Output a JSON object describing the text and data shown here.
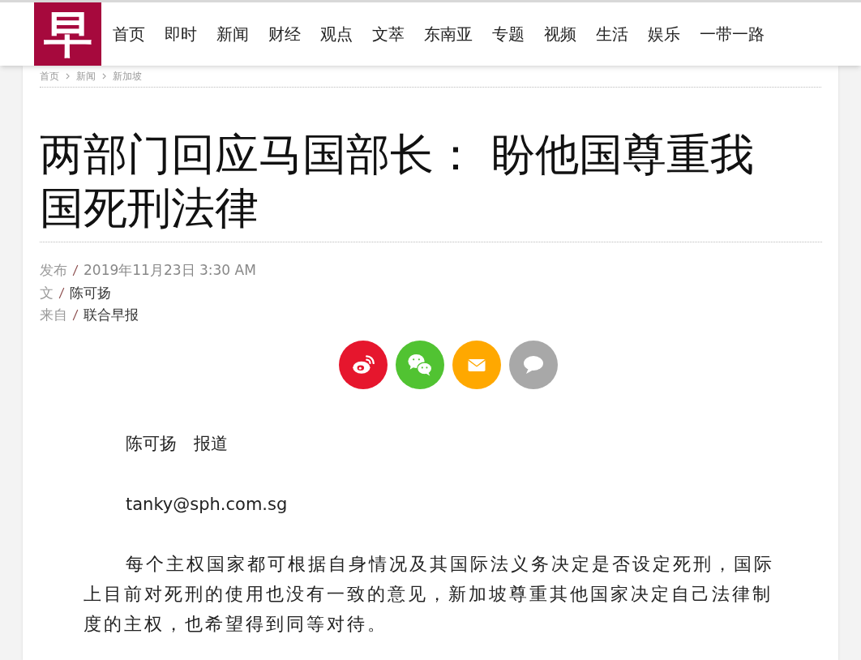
{
  "header": {
    "logo": "早",
    "nav": [
      {
        "label": "首页"
      },
      {
        "label": "即时"
      },
      {
        "label": "新闻"
      },
      {
        "label": "财经"
      },
      {
        "label": "观点"
      },
      {
        "label": "文萃"
      },
      {
        "label": "东南亚"
      },
      {
        "label": "专题"
      },
      {
        "label": "视频"
      },
      {
        "label": "生活"
      },
      {
        "label": "娱乐"
      },
      {
        "label": "一带一路"
      }
    ]
  },
  "breadcrumb": [
    "首页",
    "新闻",
    "新加坡"
  ],
  "article": {
    "title": "两部门回应马国部长： 盼他国尊重我国死刑法律",
    "meta": [
      {
        "label": "发布",
        "value": "2019年11月23日 3:30 AM",
        "kind": "muted"
      },
      {
        "label": "文",
        "value": "陈可扬",
        "kind": "dark"
      },
      {
        "label": "来自",
        "value": "联合早报",
        "kind": "dark"
      }
    ],
    "share": [
      {
        "kind": "weibo",
        "color": "#e6162d"
      },
      {
        "kind": "wechat",
        "color": "#51c332"
      },
      {
        "kind": "email",
        "color": "#ffa800"
      },
      {
        "kind": "comment",
        "color": "#a8a8a8"
      }
    ],
    "byline": "陈可扬　报道",
    "email": "tanky@sph.com.sg",
    "paragraphs": [
      "每个主权国家都可根据自身情况及其国际法义务决定是否设定死刑，国际上目前对死刑的使用也没有一致的意见，新加坡尊重其他国家决定自己法律制度的主权，也希望得到同等对待。"
    ]
  }
}
